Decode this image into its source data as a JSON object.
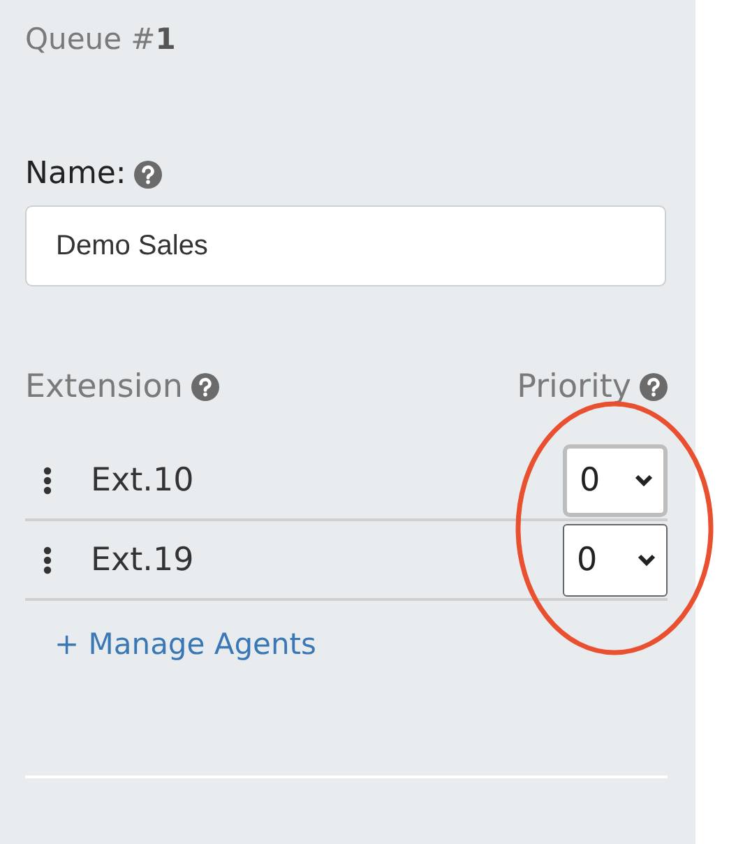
{
  "queue_title": "Queue #**1**",
  "name_field": {
    "label": "Name:",
    "value": "Demo Sales"
  },
  "agents_table": {
    "columns": [
      "Extension",
      "Priority"
    ],
    "rows": [
      {
        "extension": "Ext.10",
        "priority": "0",
        "focused": true
      },
      {
        "extension": "Ext.19",
        "priority": "0",
        "focused": false
      }
    ]
  },
  "manage_link": "+ Manage Agents",
  "annotation": {
    "kind": "ellipse",
    "color": "#e8502f"
  }
}
